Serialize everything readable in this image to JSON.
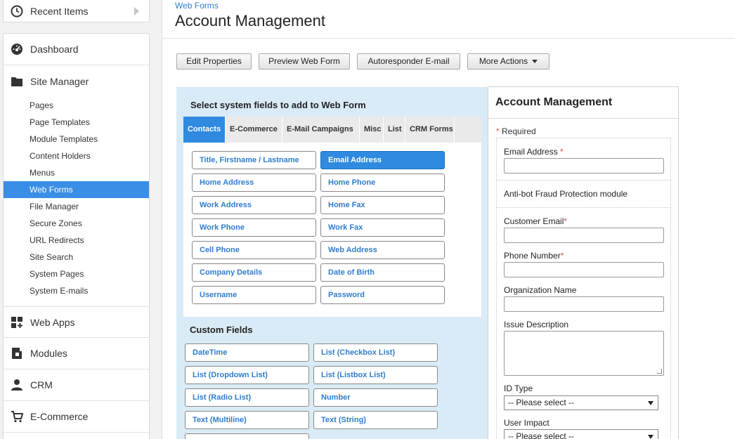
{
  "sidebar": {
    "recent": {
      "label": "Recent Items",
      "icon": "clock-icon"
    },
    "sections": [
      {
        "label": "Dashboard",
        "icon": "dashboard-icon"
      },
      {
        "label": "Site Manager",
        "icon": "folder-icon"
      },
      {
        "label": "Web Apps",
        "icon": "web-apps-icon"
      },
      {
        "label": "Modules",
        "icon": "modules-icon"
      },
      {
        "label": "CRM",
        "icon": "person-icon"
      },
      {
        "label": "E-Commerce",
        "icon": "cart-icon"
      }
    ],
    "site_manager_items": [
      "Pages",
      "Page Templates",
      "Module Templates",
      "Content Holders",
      "Menus",
      "Web Forms",
      "File Manager",
      "Secure Zones",
      "URL Redirects",
      "Site Search",
      "System Pages",
      "System E-mails"
    ],
    "active_item": "Web Forms",
    "accent_color": "#3a8ee6"
  },
  "header": {
    "breadcrumb": "Web Forms",
    "title": "Account Management"
  },
  "toolbar": {
    "edit_properties": "Edit Properties",
    "preview_web_form": "Preview Web Form",
    "autoresponder": "Autoresponder E-mail",
    "more_actions": "More Actions"
  },
  "builder": {
    "title": "Select system fields to add to Web Form",
    "tabs": [
      "Contacts",
      "E-Commerce",
      "E-Mail Campaigns",
      "Misc",
      "List",
      "CRM Forms"
    ],
    "active_tab": "Contacts",
    "system_fields": [
      "Title, Firstname / Lastname",
      "Email Address",
      "Home Address",
      "Home Phone",
      "Work Address",
      "Home Fax",
      "Work Phone",
      "Work Fax",
      "Cell Phone",
      "Web Address",
      "Company Details",
      "Date of Birth",
      "Username",
      "Password"
    ],
    "selected_field": "Email Address",
    "custom_title": "Custom Fields",
    "custom_fields": [
      "DateTime",
      "List (Checkbox List)",
      "List (Dropdown List)",
      "List (Listbox List)",
      "List (Radio List)",
      "Number",
      "Text (Multiline)",
      "Text (String)",
      ""
    ]
  },
  "preview": {
    "title": "Account Management",
    "required_note": "Required",
    "star": "*",
    "email_label": "Email Address",
    "antibot": "Anti-bot Fraud Protection module",
    "customer_email_label": "Customer Email",
    "phone_label": "Phone Number",
    "org_label": "Organization Name",
    "issue_label": "Issue Description",
    "id_type_label": "ID Type",
    "id_type_value": "-- Please select --",
    "user_impact_label": "User Impact",
    "user_impact_value": "-- Please select --"
  }
}
